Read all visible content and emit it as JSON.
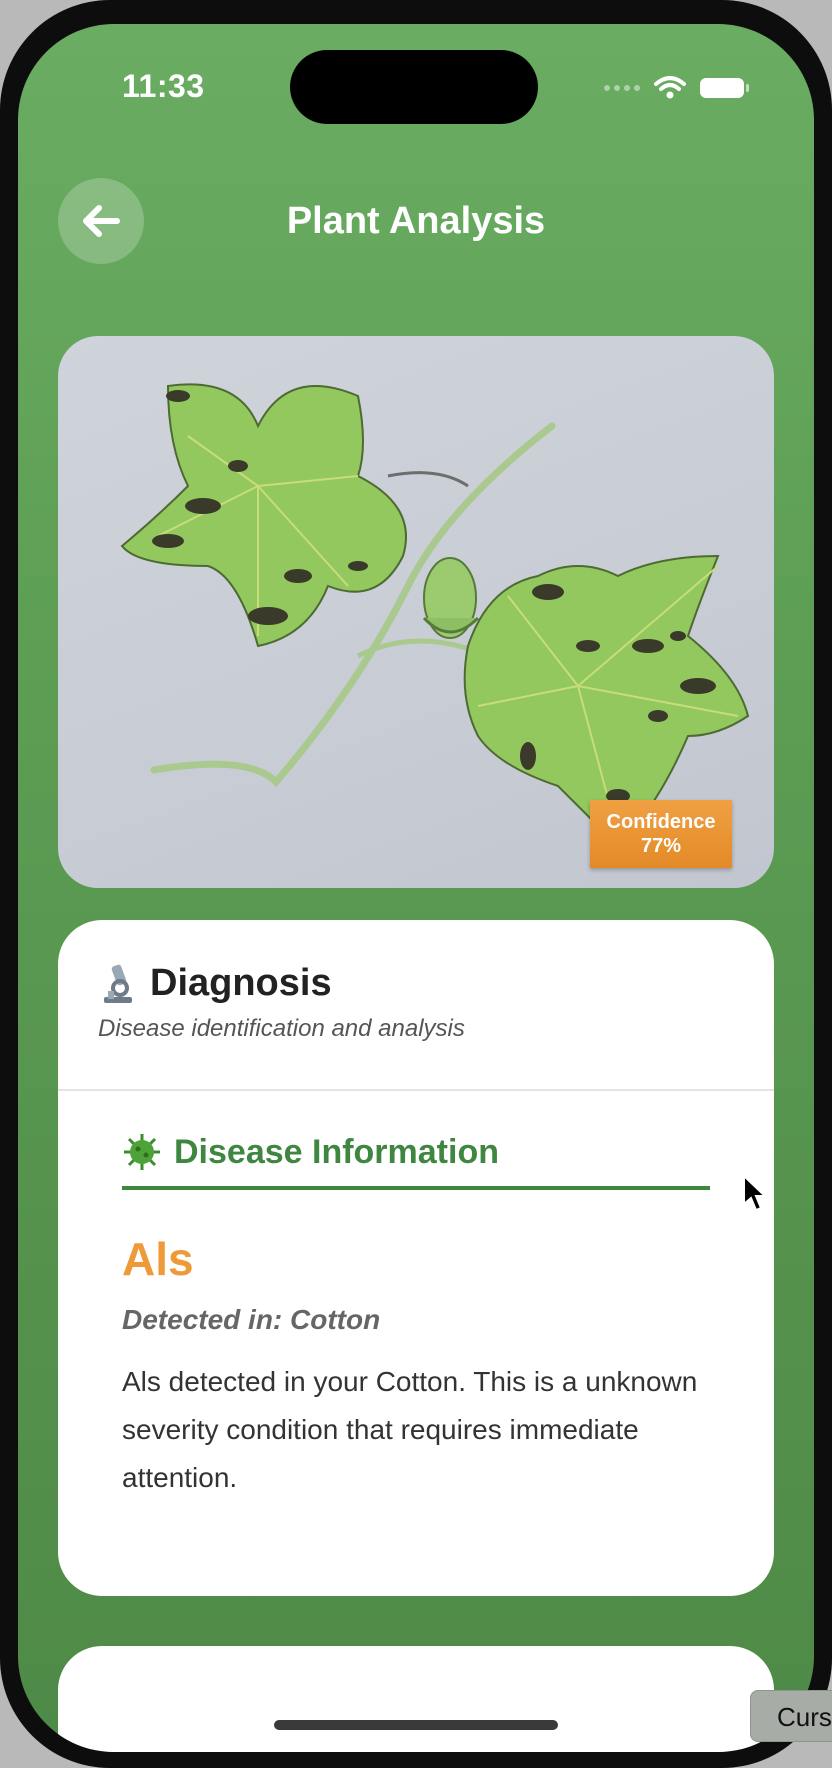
{
  "status": {
    "time": "11:33"
  },
  "header": {
    "title": "Plant Analysis"
  },
  "photo": {
    "confidence_label": "Confidence",
    "confidence_value": "77%"
  },
  "diagnosis": {
    "title": "Diagnosis",
    "subtitle": "Disease identification and analysis",
    "section_title": "Disease Information",
    "disease_name": "Als",
    "detected_in": "Detected in: Cotton",
    "description": "Als detected in your Cotton. This is a unknown severity condition that requires immediate attention."
  },
  "tooltip": {
    "text": "Curs"
  },
  "icons": {
    "back": "arrow-left-icon",
    "diagnosis": "microscope-icon",
    "section": "virus-icon"
  }
}
